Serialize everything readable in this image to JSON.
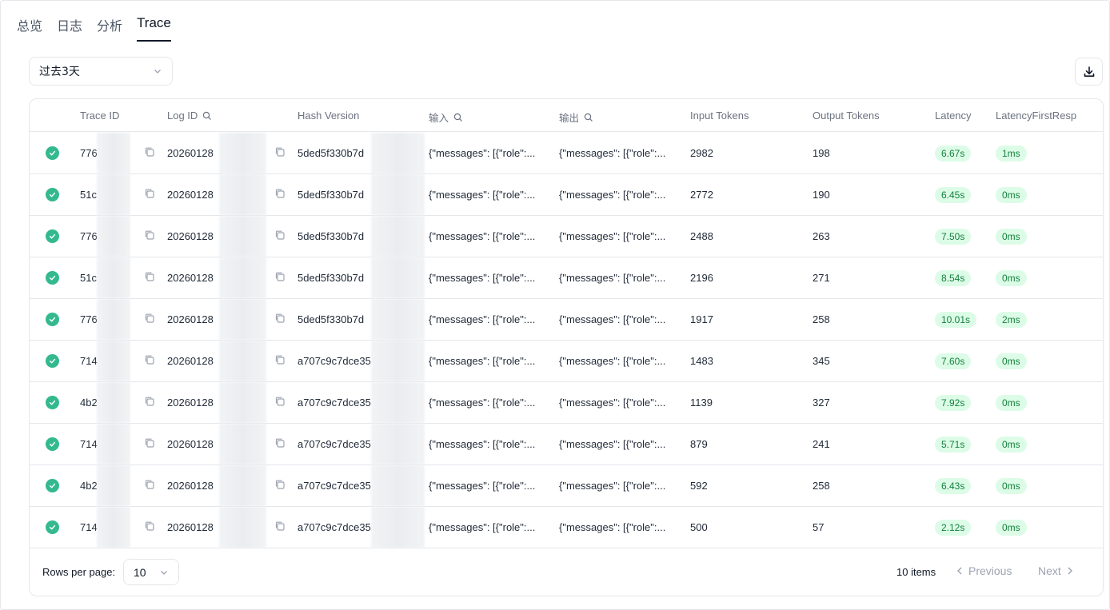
{
  "tabs": [
    {
      "label": "总览",
      "active": false
    },
    {
      "label": "日志",
      "active": false
    },
    {
      "label": "分析",
      "active": false
    },
    {
      "label": "Trace",
      "active": true
    }
  ],
  "filter": {
    "range_value": "过去3天"
  },
  "table": {
    "columns": {
      "trace_id": "Trace ID",
      "log_id": "Log ID",
      "hash_version": "Hash Version",
      "input": "输入",
      "output": "输出",
      "input_tokens": "Input Tokens",
      "output_tokens": "Output Tokens",
      "latency": "Latency",
      "latency_first": "LatencyFirstResp"
    },
    "rows": [
      {
        "trace": "776",
        "log": "20260128",
        "hash": "5ded5f330b7d",
        "input": "{\"messages\": [{\"role\":...",
        "output": "{\"messages\": [{\"role\":...",
        "in_tok": "2982",
        "out_tok": "198",
        "latency": "6.67s",
        "first": "1ms"
      },
      {
        "trace": "51c",
        "log": "20260128",
        "hash": "5ded5f330b7d",
        "input": "{\"messages\": [{\"role\":...",
        "output": "{\"messages\": [{\"role\":...",
        "in_tok": "2772",
        "out_tok": "190",
        "latency": "6.45s",
        "first": "0ms"
      },
      {
        "trace": "776",
        "log": "20260128",
        "hash": "5ded5f330b7d",
        "input": "{\"messages\": [{\"role\":...",
        "output": "{\"messages\": [{\"role\":...",
        "in_tok": "2488",
        "out_tok": "263",
        "latency": "7.50s",
        "first": "0ms"
      },
      {
        "trace": "51c",
        "log": "20260128",
        "hash": "5ded5f330b7d",
        "input": "{\"messages\": [{\"role\":...",
        "output": "{\"messages\": [{\"role\":...",
        "in_tok": "2196",
        "out_tok": "271",
        "latency": "8.54s",
        "first": "0ms"
      },
      {
        "trace": "776",
        "log": "20260128",
        "hash": "5ded5f330b7d",
        "input": "{\"messages\": [{\"role\":...",
        "output": "{\"messages\": [{\"role\":...",
        "in_tok": "1917",
        "out_tok": "258",
        "latency": "10.01s",
        "first": "2ms"
      },
      {
        "trace": "714",
        "log": "20260128",
        "hash": "a707c9c7dce35",
        "input": "{\"messages\": [{\"role\":...",
        "output": "{\"messages\": [{\"role\":...",
        "in_tok": "1483",
        "out_tok": "345",
        "latency": "7.60s",
        "first": "0ms"
      },
      {
        "trace": "4b2",
        "log": "20260128",
        "hash": "a707c9c7dce35",
        "input": "{\"messages\": [{\"role\":...",
        "output": "{\"messages\": [{\"role\":...",
        "in_tok": "1139",
        "out_tok": "327",
        "latency": "7.92s",
        "first": "0ms"
      },
      {
        "trace": "714",
        "log": "20260128",
        "hash": "a707c9c7dce35",
        "input": "{\"messages\": [{\"role\":...",
        "output": "{\"messages\": [{\"role\":...",
        "in_tok": "879",
        "out_tok": "241",
        "latency": "5.71s",
        "first": "0ms"
      },
      {
        "trace": "4b2",
        "log": "20260128",
        "hash": "a707c9c7dce35",
        "input": "{\"messages\": [{\"role\":...",
        "output": "{\"messages\": [{\"role\":...",
        "in_tok": "592",
        "out_tok": "258",
        "latency": "6.43s",
        "first": "0ms"
      },
      {
        "trace": "714",
        "log": "20260128",
        "hash": "a707c9c7dce35",
        "input": "{\"messages\": [{\"role\":...",
        "output": "{\"messages\": [{\"role\":...",
        "in_tok": "500",
        "out_tok": "57",
        "latency": "2.12s",
        "first": "0ms"
      }
    ]
  },
  "pagination": {
    "rows_per_page_label": "Rows per page:",
    "rows_per_page_value": "10",
    "items_count": "10 items",
    "previous_label": "Previous",
    "next_label": "Next"
  },
  "colors": {
    "status_success": "#34b98f",
    "pill_bg": "#dcfce7",
    "pill_text": "#15803d"
  },
  "icons": [
    "chevron-down-icon",
    "download-icon",
    "search-icon",
    "copy-icon",
    "check-circle-icon",
    "chevron-left-icon",
    "chevron-right-icon"
  ]
}
